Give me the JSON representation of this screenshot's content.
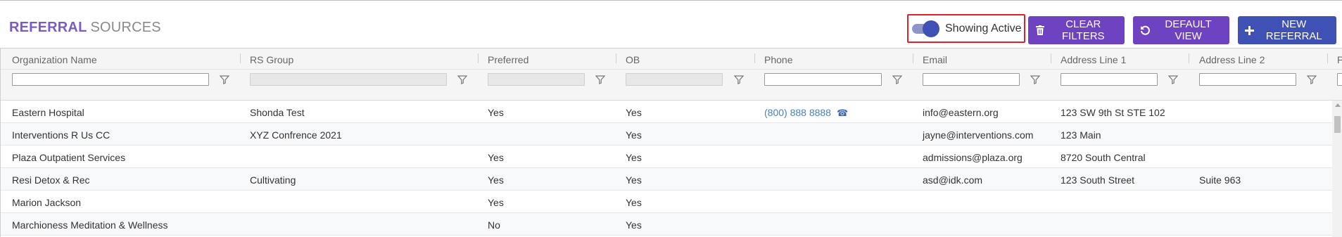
{
  "header": {
    "title_strong": "REFERRAL",
    "title_rest": "SOURCES",
    "toggle_label": "Showing Active",
    "buttons": {
      "clear_filters": "CLEAR FILTERS",
      "default_view": "DEFAULT VIEW",
      "new_referral": "NEW REFERRAL"
    }
  },
  "colors": {
    "accent_purple": "#6f42c1",
    "accent_indigo": "#3f51b5",
    "highlight_border": "#e0202a",
    "link": "#4a7fc1"
  },
  "grid": {
    "columns": [
      {
        "label": "Organization Name"
      },
      {
        "label": "RS Group"
      },
      {
        "label": "Preferred"
      },
      {
        "label": "OB"
      },
      {
        "label": "Phone"
      },
      {
        "label": "Email"
      },
      {
        "label": "Address Line 1"
      },
      {
        "label": "Address Line 2"
      },
      {
        "label": "P"
      }
    ],
    "rows": [
      {
        "org": "Eastern Hospital",
        "group": "Shonda Test",
        "preferred": "Yes",
        "ob": "Yes",
        "phone": "(800) 888 8888",
        "email": "info@eastern.org",
        "addr1": "123 SW 9th St STE 102",
        "addr2": ""
      },
      {
        "org": "Interventions R Us CC",
        "group": "XYZ Confrence 2021",
        "preferred": "",
        "ob": "Yes",
        "phone": "",
        "email": "jayne@interventions.com",
        "addr1": "123 Main",
        "addr2": ""
      },
      {
        "org": "Plaza Outpatient Services",
        "group": "",
        "preferred": "Yes",
        "ob": "Yes",
        "phone": "",
        "email": "admissions@plaza.org",
        "addr1": "8720 South Central",
        "addr2": ""
      },
      {
        "org": "Resi Detox & Rec",
        "group": "Cultivating",
        "preferred": "Yes",
        "ob": "Yes",
        "phone": "",
        "email": "asd@idk.com",
        "addr1": "123 South Street",
        "addr2": "Suite 963"
      },
      {
        "org": "Marion Jackson",
        "group": "",
        "preferred": "Yes",
        "ob": "Yes",
        "phone": "",
        "email": "",
        "addr1": "",
        "addr2": ""
      },
      {
        "org": "Marchioness Meditation & Wellness",
        "group": "",
        "preferred": "No",
        "ob": "Yes",
        "phone": "",
        "email": "",
        "addr1": "",
        "addr2": ""
      }
    ]
  }
}
